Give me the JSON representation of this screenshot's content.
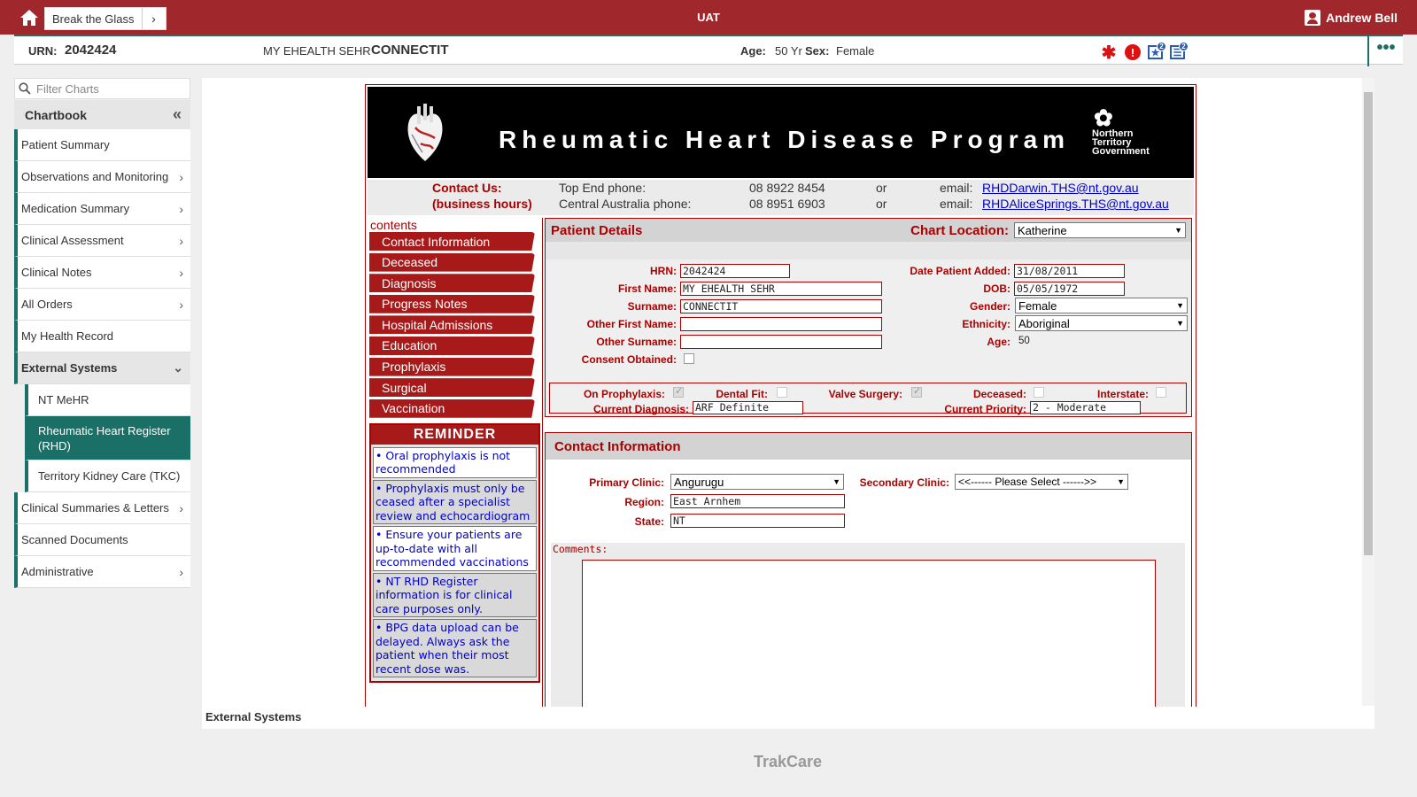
{
  "topbar": {
    "break_glass": "Break the Glass",
    "env": "UAT",
    "user": "Andrew Bell"
  },
  "patient_bar": {
    "urn_label": "URN:",
    "urn": "2042424",
    "given": "MY EHEALTH SEHR",
    "family": "CONNECTIT",
    "age_label": "Age:",
    "age": "50 Yr",
    "sex_label": "Sex:",
    "sex": "Female",
    "badge1": "2",
    "badge2": "2"
  },
  "sidebar": {
    "filter_placeholder": "Filter Charts",
    "chartbook": "Chartbook",
    "items": [
      {
        "label": "Patient Summary"
      },
      {
        "label": "Observations and Monitoring"
      },
      {
        "label": "Medication Summary"
      },
      {
        "label": "Clinical Assessment"
      },
      {
        "label": "Clinical Notes"
      },
      {
        "label": "All Orders"
      },
      {
        "label": "My Health Record"
      },
      {
        "label": "External Systems"
      },
      {
        "label": "NT MeHR"
      },
      {
        "label": "Rheumatic Heart Register (RHD)"
      },
      {
        "label": "Territory Kidney Care (TKC)"
      },
      {
        "label": "Clinical Summaries & Letters"
      },
      {
        "label": "Scanned Documents"
      },
      {
        "label": "Administrative"
      }
    ]
  },
  "breadcrumb": "External Systems",
  "footer": "TrakCare",
  "rhd": {
    "title": "Rheumatic Heart Disease Program",
    "ntg": [
      "Northern",
      "Territory",
      "Government"
    ],
    "contact_label": "Contact Us:",
    "hours_label": "(business hours)",
    "top_end_label": "Top End phone:",
    "top_end_phone": "08 8922 8454",
    "central_label": "Central Australia phone:",
    "central_phone": "08 8951 6903",
    "or": "or",
    "email_label": "email:",
    "email1": "RHDDarwin.THS@nt.gov.au",
    "email2": "RHDAliceSprings.THS@nt.gov.au",
    "contents_label": "contents",
    "tabs": [
      "Contact Information",
      "Deceased",
      "Diagnosis",
      "Progress Notes",
      "Hospital Admissions",
      "Education",
      "Prophylaxis",
      "Surgical",
      "Vaccination"
    ],
    "reminder_title": "REMINDER",
    "reminders": [
      "•   Oral prophylaxis is not recommended",
      "•   Prophylaxis must only be ceased after a specialist review and echocardiogram",
      "•   Ensure your patients are up-to-date with all recommended vaccinations",
      "•   NT RHD Register information is for clinical care purposes only.",
      "•   BPG data upload can be delayed. Always ask the patient when their most recent dose was."
    ],
    "pd_title": "Patient Details",
    "chart_location_label": "Chart Location:",
    "chart_location": "Katherine",
    "hrn_label": "HRN:",
    "hrn": "2042424",
    "first_name_label": "First Name:",
    "first_name": "MY EHEALTH SEHR",
    "surname_label": "Surname:",
    "surname": "CONNECTIT",
    "other_first_label": "Other First Name:",
    "other_first": "",
    "other_surname_label": "Other Surname:",
    "other_surname": "",
    "consent_label": "Consent Obtained:",
    "date_added_label": "Date Patient Added:",
    "date_added": "31/08/2011",
    "dob_label": "DOB:",
    "dob": "05/05/1972",
    "gender_label": "Gender:",
    "gender": "Female",
    "ethnicity_label": "Ethnicity:",
    "ethnicity": "Aboriginal",
    "age_label": "Age:",
    "age": "50",
    "on_prophylaxis_label": "On Prophylaxis:",
    "dental_fit_label": "Dental Fit:",
    "valve_surgery_label": "Valve Surgery:",
    "deceased_label": "Deceased:",
    "interstate_label": "Interstate:",
    "current_diagnosis_label": "Current Diagnosis:",
    "current_diagnosis": "ARF Definite",
    "current_priority_label": "Current Priority:",
    "current_priority": "2 - Moderate",
    "ci_title": "Contact Information",
    "primary_clinic_label": "Primary Clinic:",
    "primary_clinic": "Angurugu",
    "secondary_clinic_label": "Secondary Clinic:",
    "secondary_clinic": "<<------ Please Select ------>>",
    "region_label": "Region:",
    "region": "East Arnhem",
    "state_label": "State:",
    "state": "NT",
    "comments_label": "Comments:"
  }
}
